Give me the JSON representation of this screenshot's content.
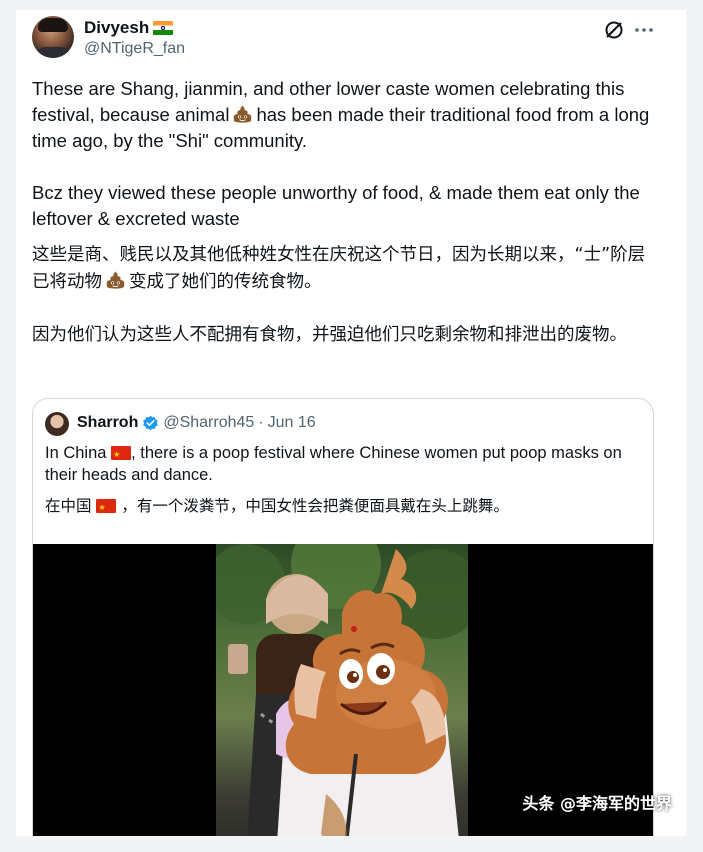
{
  "tweet": {
    "author_name": "Divyesh",
    "author_flag_icon": "india-flag-icon",
    "author_handle": "@NTigeR_fan",
    "paragraph_en_1_part1": "These are Shang, jianmin, and other lower caste women celebrating this festival, because animal",
    "paragraph_en_1_part2": "has been made their traditional food from a long time ago, by the \"Shi\" community.",
    "paragraph_en_2": "Bcz they viewed these people unworthy of food, & made them eat only the leftover & excreted waste",
    "paragraph_zh_1_part1": "这些是商、贱民以及其他低种姓女性在庆祝这个节日，因为长期以来，“士”阶层已将动物",
    "paragraph_zh_1_part2": "变成了她们的传统食物。",
    "paragraph_zh_2": "因为他们认为这些人不配拥有食物，并强迫他们只吃剩余物和排泄出的废物。"
  },
  "quote": {
    "name": "Sharroh",
    "handle": "@Sharroh45",
    "separator": "·",
    "date": "Jun 16",
    "text_en_part1": "In China",
    "text_en_part2": ", there is a poop festival where Chinese women put poop masks on their heads and dance.",
    "text_zh_part1": "在中国",
    "text_zh_part2": "，有一个泼粪节，中国女性会把粪便面具戴在头上跳舞。"
  },
  "watermark": "头条 @李海军的世界",
  "colors": {
    "verified_blue": "#1d9bf0",
    "secondary_text": "#536471",
    "border": "#cfd9de",
    "poop_brown": "#8b5a2b"
  }
}
